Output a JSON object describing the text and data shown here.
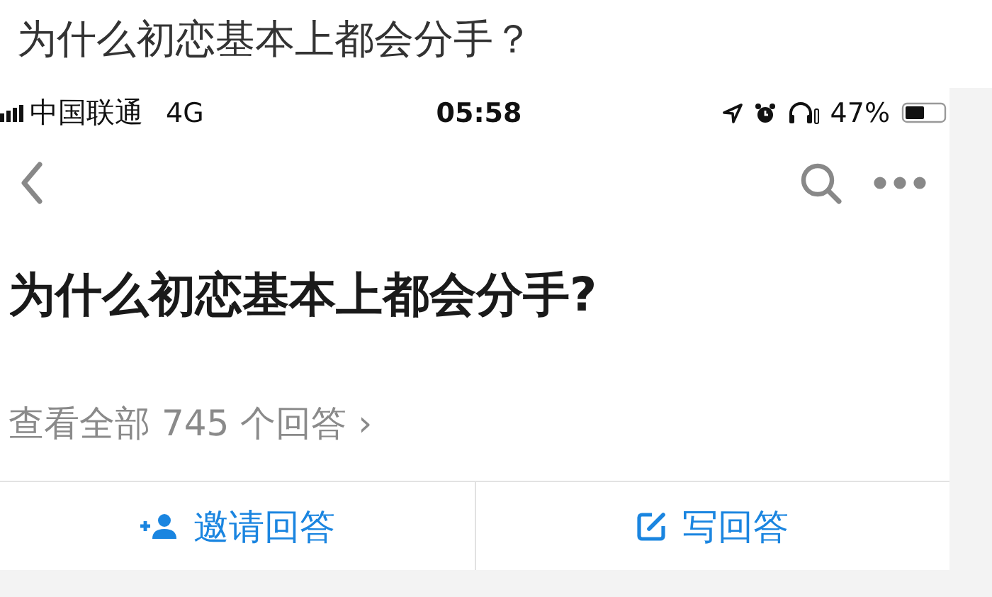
{
  "caption": "为什么初恋基本上都会分手？",
  "status_bar": {
    "carrier": "中国联通",
    "network": "4G",
    "time": "05:58",
    "battery": "47%"
  },
  "question": {
    "title": "为什么初恋基本上都会分手?",
    "answers_link": "查看全部 745 个回答",
    "chevron": "›"
  },
  "actions": [
    {
      "kind": "invite",
      "label": "邀请回答"
    },
    {
      "kind": "write",
      "label": "写回答"
    }
  ]
}
